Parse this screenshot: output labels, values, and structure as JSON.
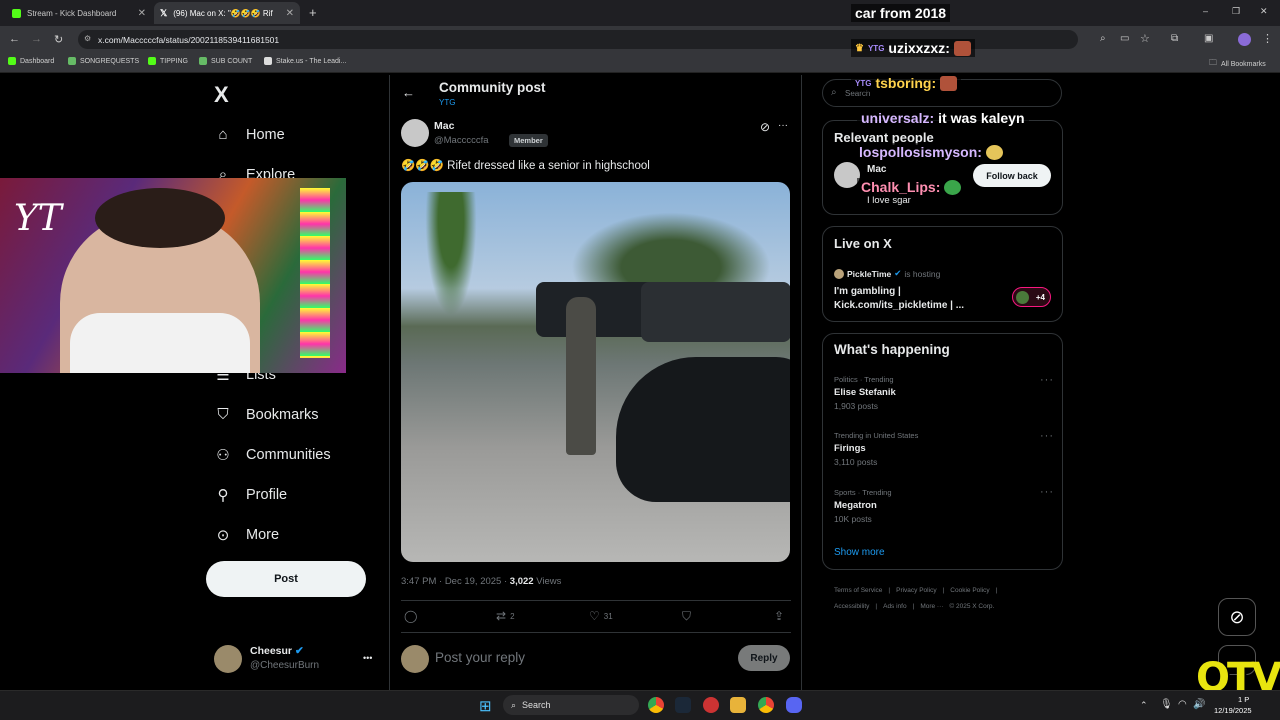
{
  "browser": {
    "tabs": [
      {
        "label": "Stream - Kick Dashboard",
        "favicon": "kick-icon",
        "active": false
      },
      {
        "label": "(96) Mac on X: \"🤣🤣🤣 Rifet",
        "favicon": "x-icon",
        "active": true
      }
    ],
    "new_tab": "+",
    "url": "x.com/Macccccfa/status/2002118539411681501",
    "bookmarks": [
      "Dashboard",
      "SONGREQUESTS",
      "TIPPING",
      "SUB COUNT",
      "Stake.us - The Leadi..."
    ],
    "all_bookmarks": "All Bookmarks",
    "window_controls": [
      "–",
      "❐",
      "✕"
    ]
  },
  "nav": {
    "logo": "X",
    "items": [
      "Home",
      "Explore",
      "Lists",
      "Bookmarks",
      "Communities",
      "Profile",
      "More"
    ],
    "post_button": "Post",
    "account": {
      "name": "Cheesur",
      "handle": "@CheesurBurn",
      "more": "•••"
    }
  },
  "post": {
    "header_title": "Community post",
    "header_sub": "YTG",
    "author_name": "Mac",
    "author_handle": "@Macccccfa",
    "member_badge": "Member",
    "text": "🤣🤣🤣 Rifet dressed like a senior in highschool",
    "timestamp": "3:47 PM · Dec 19, 2025 · ",
    "views_count": "3,022",
    "views_label": " Views",
    "retweets": "2",
    "likes": "31",
    "reply_placeholder": "Post your reply",
    "reply_button": "Reply"
  },
  "sidebar": {
    "search_placeholder": "Search",
    "relevant_title": "Relevant people",
    "relevant_name": "Mac",
    "relevant_bio": "I love sgar",
    "follow_back": "Follow back",
    "live_title": "Live on X",
    "live_host": "PickleTime",
    "live_hosting": "is hosting",
    "live_title_text": "I'm gambling | Kick.com/its_pickletime | ...",
    "live_extra": "+4",
    "happening_title": "What's happening",
    "trends": [
      {
        "context": "Politics · Trending",
        "name": "Elise Stefanik",
        "posts": "1,903 posts"
      },
      {
        "context": "Trending in United States",
        "name": "Firings",
        "posts": "3,110 posts"
      },
      {
        "context": "Sports · Trending",
        "name": "Megatron",
        "posts": "10K posts"
      }
    ],
    "show_more": "Show more",
    "footer_line1": [
      "Terms of Service",
      "|",
      "Privacy Policy",
      "|",
      "Cookie Policy",
      "|"
    ],
    "footer_line2": [
      "Accessibility",
      "|",
      "Ads info",
      "|",
      "More ···",
      "© 2025 X Corp."
    ]
  },
  "chat": [
    {
      "user": "car from 2018",
      "msg": "",
      "color": "#ffffff"
    },
    {
      "user": "uzixxzxz:",
      "msg": "",
      "color": "#ffffff"
    },
    {
      "user": "tsboring:",
      "msg": "",
      "color": "#ffd34d"
    },
    {
      "user": "universalz:",
      "msg": "it was kaleyn",
      "color": "#d6b8ff"
    },
    {
      "user": "lospollosismyson:",
      "msg": "",
      "color": "#d6b8ff"
    },
    {
      "user": "Chalk_Lips:",
      "msg": "",
      "color": "#ff8fb1"
    }
  ],
  "webcam": {
    "overlay_text": "YT"
  },
  "taskbar": {
    "search": "Search",
    "time": "1 P",
    "date": "12/19/2025"
  },
  "brand": {
    "watermark": "OTV",
    "accent": "#1d9bf0",
    "kick_green": "#53fc18"
  }
}
